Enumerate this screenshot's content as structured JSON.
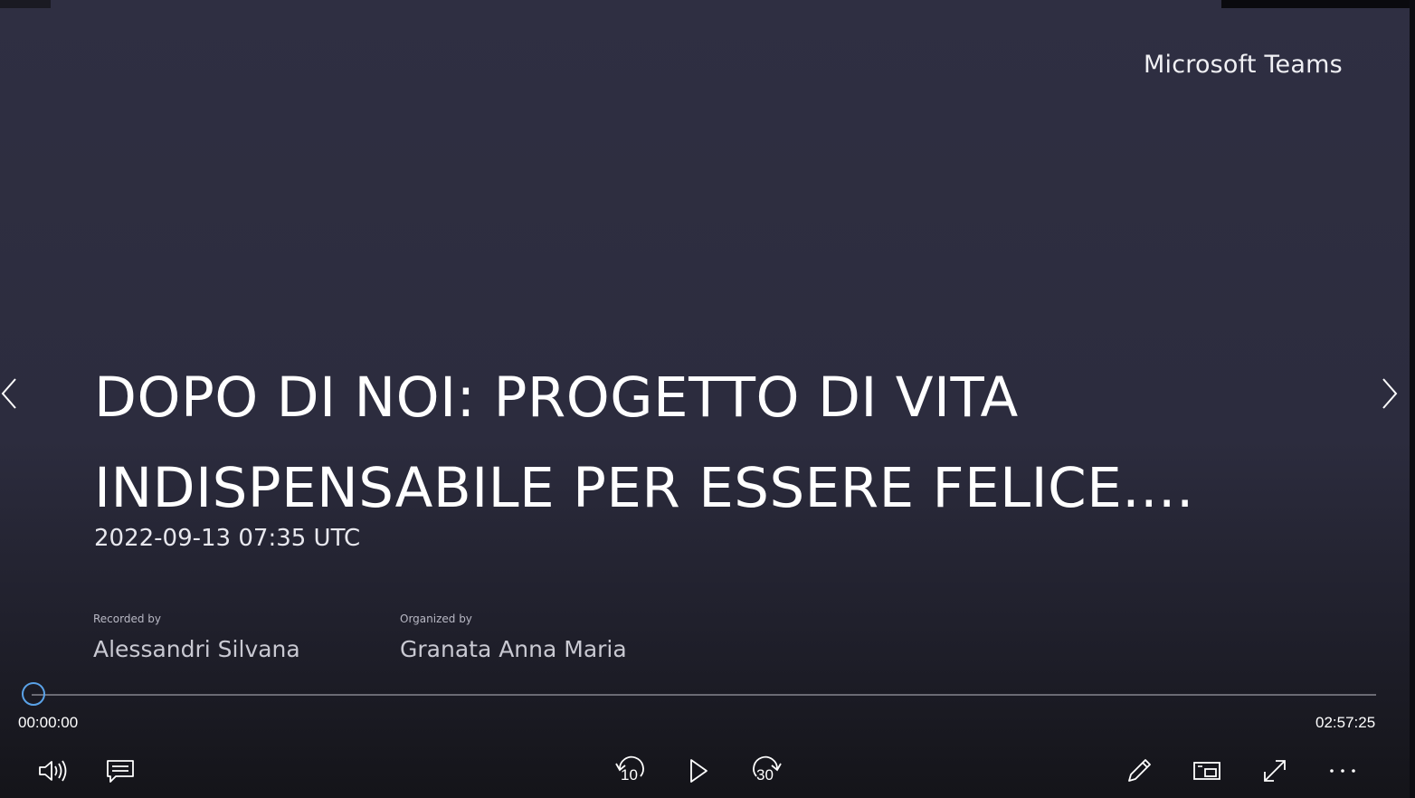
{
  "app": {
    "brand": "Microsoft Teams"
  },
  "slide": {
    "title_line_1": "DOPO DI NOI: PROGETTO DI VITA",
    "title_line_2": "INDISPENSABILE PER ESSERE FELICE....",
    "date": "2022-09-13 07:35 UTC",
    "recorded_by_label": "Recorded by",
    "recorded_by_value": "Alessandri Silvana",
    "organized_by_label": "Organized by",
    "organized_by_value": "Granata Anna Maria"
  },
  "player": {
    "current_time": "00:00:00",
    "total_time": "02:57:25",
    "progress_fraction": 0,
    "skip_back_seconds": "10",
    "skip_forward_seconds": "30",
    "colors": {
      "seek_thumb": "#5aa2e8",
      "seek_track": "#6b6b74",
      "icon": "#ffffff"
    },
    "controls": {
      "volume_icon": "speaker-icon",
      "captions_icon": "captions-icon",
      "skip_back_icon": "rewind-10-icon",
      "play_icon": "play-icon",
      "skip_forward_icon": "forward-30-icon",
      "annotate_icon": "pencil-icon",
      "picture_in_picture_icon": "picture-in-picture-icon",
      "fullscreen_icon": "expand-icon",
      "more_icon": "more-icon"
    }
  }
}
